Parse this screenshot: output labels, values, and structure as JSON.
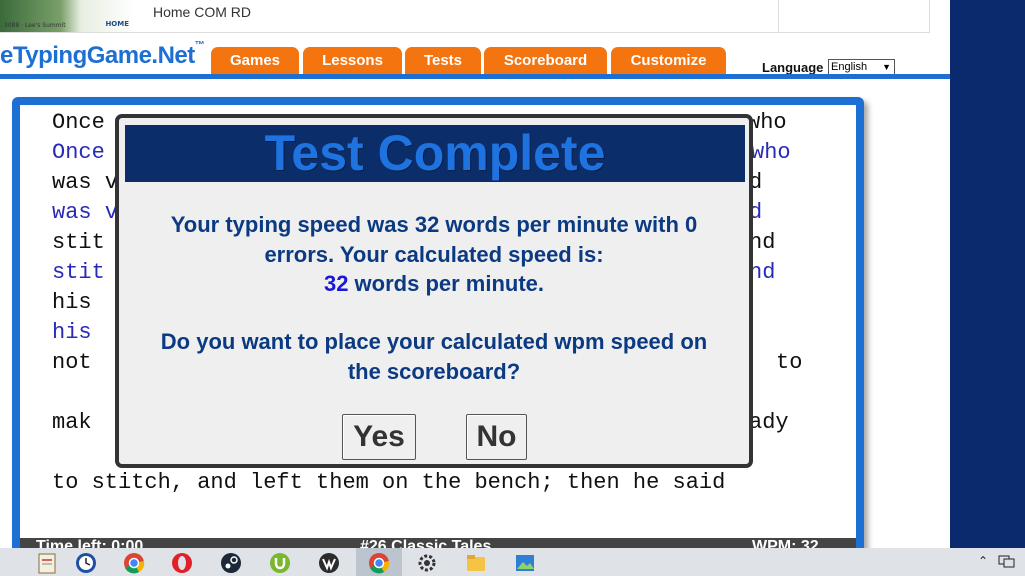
{
  "ad": {
    "banner_small_text": "3088 · Lee's Summit",
    "banner_logo": "HOME",
    "link_text": "Home COM RD"
  },
  "header": {
    "logo_text": "eTypingGame.Net",
    "logo_mark": "™",
    "tabs": [
      {
        "label": "Games"
      },
      {
        "label": "Lessons"
      },
      {
        "label": "Tests"
      },
      {
        "label": "Scoreboard"
      },
      {
        "label": "Customize"
      }
    ],
    "language_label": "Language",
    "language_value": "English"
  },
  "typing_text": {
    "lines": [
      {
        "left": "Once",
        "right": "who"
      },
      {
        "left": "Once",
        "right": "who"
      },
      {
        "left": "was v",
        "right": "d"
      },
      {
        "left": "was v",
        "right": "d"
      },
      {
        "left": "stit",
        "right": "nd"
      },
      {
        "left": "stit",
        "right": "nd"
      },
      {
        "left": "his",
        "right": ""
      },
      {
        "left": "his",
        "right": ""
      },
      {
        "left": "not",
        "right": "to"
      },
      {
        "left": "mak",
        "right": "ady"
      }
    ],
    "full_line": "to stitch, and left them on the bench; then he said"
  },
  "status_bar": {
    "time_left": "Time left: 0:00",
    "title": "#26 Classic Tales",
    "wpm": "WPM: 32"
  },
  "modal": {
    "title": "Test Complete",
    "line1": "Your typing speed was 32 words per minute with 0",
    "line2": "errors. Your calculated speed is:",
    "wpm_value": "32",
    "wpm_suffix": " words per minute.",
    "question_line1": "Do you want to place your calculated wpm speed on",
    "question_line2": "the scoreboard?",
    "yes_label": "Yes",
    "no_label": "No"
  },
  "colors": {
    "brand_blue": "#1e6fd4",
    "tab_orange": "#f4740f",
    "modal_header": "#0b2e6b",
    "typed_text": "#2a2ab8"
  },
  "taskbar": {
    "icons": [
      "notepad-icon",
      "clock-icon",
      "chrome-icon",
      "opera-icon",
      "steam-icon",
      "utorrent-icon",
      "wolf-icon",
      "chrome-active-icon",
      "settings-icon",
      "file-explorer-icon",
      "photos-icon"
    ]
  }
}
